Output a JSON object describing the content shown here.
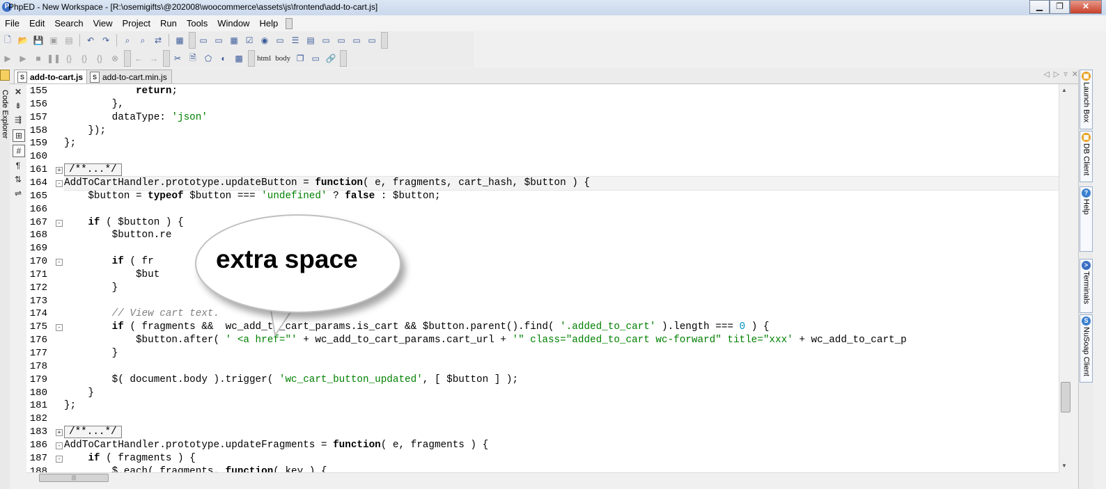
{
  "window": {
    "title": "PhpED - New Workspace - [R:\\osemigifts\\@202008\\woocommerce\\assets\\js\\frontend\\add-to-cart.js]",
    "minimize": "▁",
    "restore": "❐",
    "close": "✕"
  },
  "menu": [
    "File",
    "Edit",
    "Search",
    "View",
    "Project",
    "Run",
    "Tools",
    "Window",
    "Help"
  ],
  "toolbar": {
    "html_label": "html",
    "body_label": "body"
  },
  "left_panel": {
    "label": "Code Explorer"
  },
  "tabs": [
    {
      "label": "add-to-cart.js",
      "active": true
    },
    {
      "label": "add-to-cart.min.js",
      "active": false
    }
  ],
  "editor": {
    "lines": [
      {
        "no": "155",
        "fold": "",
        "html": "            <span class='kw'>return</span>;"
      },
      {
        "no": "156",
        "fold": "",
        "html": "        },"
      },
      {
        "no": "157",
        "fold": "",
        "html": "        dataType: <span class='str'>'json'</span>"
      },
      {
        "no": "158",
        "fold": "",
        "html": "    });"
      },
      {
        "no": "159",
        "fold": "",
        "html": "};"
      },
      {
        "no": "160",
        "fold": "",
        "html": ""
      },
      {
        "no": "161",
        "fold": "+",
        "html": "<span class='foldbox'>/**...*/</span>"
      },
      {
        "no": "164",
        "fold": "-",
        "html": "AddToCartHandler.prototype.updateButton = <span class='kw'>function</span>( e, fragments, cart_hash, $button ) {",
        "current": true
      },
      {
        "no": "165",
        "fold": "",
        "html": "    $button = <span class='kw'>typeof</span> $button === <span class='str'>'undefined'</span> ? <span class='kw'>false</span> : $button;"
      },
      {
        "no": "166",
        "fold": "",
        "html": ""
      },
      {
        "no": "167",
        "fold": "-",
        "html": "    <span class='kw'>if</span> ( $button ) {"
      },
      {
        "no": "168",
        "fold": "",
        "html": "        $button.re"
      },
      {
        "no": "169",
        "fold": "",
        "html": ""
      },
      {
        "no": "170",
        "fold": "-",
        "html": "        <span class='kw'>if</span> ( fr"
      },
      {
        "no": "171",
        "fold": "",
        "html": "            $but"
      },
      {
        "no": "172",
        "fold": "",
        "html": "        }"
      },
      {
        "no": "173",
        "fold": "",
        "html": ""
      },
      {
        "no": "174",
        "fold": "",
        "html": "        <span class='com'>// View cart text.</span>"
      },
      {
        "no": "175",
        "fold": "-",
        "html": "        <span class='kw'>if</span> ( fragments &amp;&amp;  wc_add_to_cart_params.is_cart &amp;&amp; $button.parent().find( <span class='str'>'.added_to_cart'</span> ).length === <span class='num'>0</span> ) {"
      },
      {
        "no": "176",
        "fold": "",
        "html": "            $button.after( <span class='str'>' &lt;a href=\"'</span> + wc_add_to_cart_params.cart_url + <span class='str'>'\" class=\"added_to_cart wc-forward\" title=\"xxx'</span> + wc_add_to_cart_p"
      },
      {
        "no": "177",
        "fold": "",
        "html": "        }"
      },
      {
        "no": "178",
        "fold": "",
        "html": ""
      },
      {
        "no": "179",
        "fold": "",
        "html": "        $( document.body ).trigger( <span class='str'>'wc_cart_button_updated'</span>, [ $button ] );"
      },
      {
        "no": "180",
        "fold": "",
        "html": "    }"
      },
      {
        "no": "181",
        "fold": "",
        "html": "};"
      },
      {
        "no": "182",
        "fold": "",
        "html": ""
      },
      {
        "no": "183",
        "fold": "+",
        "html": "<span class='foldbox'>/**...*/</span>"
      },
      {
        "no": "186",
        "fold": "-",
        "html": "AddToCartHandler.prototype.updateFragments = <span class='kw'>function</span>( e, fragments ) {"
      },
      {
        "no": "187",
        "fold": "-",
        "html": "    <span class='kw'>if</span> ( fragments ) {"
      },
      {
        "no": "188",
        "fold": "",
        "html": "        $.each( fragments, <span class='kw'>function</span>( key ) {"
      }
    ]
  },
  "right_panels": [
    {
      "label": "Launch Box",
      "icon_color": "#e8a020"
    },
    {
      "label": "DB Client",
      "icon_color": "#e8a020"
    },
    {
      "label": "Help",
      "icon_color": "#3a7fd0"
    },
    {
      "label": "Terminals",
      "icon_color": "#3a6fc4"
    },
    {
      "label": "NuSoap Client",
      "icon_color": "#3a7fd0"
    }
  ],
  "annotation": {
    "text": "extra space"
  }
}
